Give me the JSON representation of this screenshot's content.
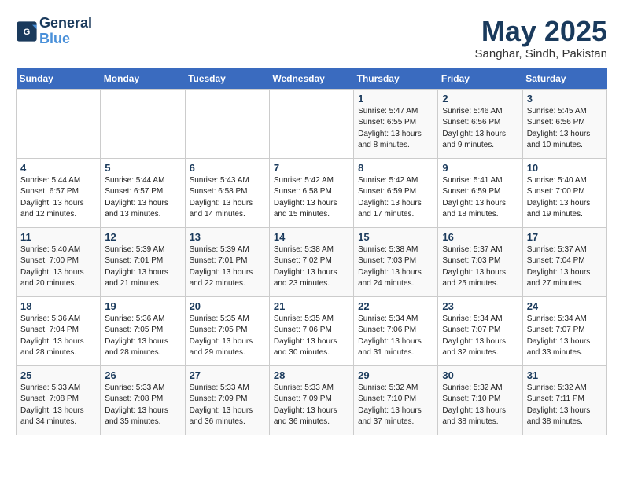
{
  "header": {
    "logo_line1": "General",
    "logo_line2": "Blue",
    "month": "May 2025",
    "location": "Sanghar, Sindh, Pakistan"
  },
  "days_of_week": [
    "Sunday",
    "Monday",
    "Tuesday",
    "Wednesday",
    "Thursday",
    "Friday",
    "Saturday"
  ],
  "weeks": [
    [
      {
        "day": "",
        "info": ""
      },
      {
        "day": "",
        "info": ""
      },
      {
        "day": "",
        "info": ""
      },
      {
        "day": "",
        "info": ""
      },
      {
        "day": "1",
        "info": "Sunrise: 5:47 AM\nSunset: 6:55 PM\nDaylight: 13 hours\nand 8 minutes."
      },
      {
        "day": "2",
        "info": "Sunrise: 5:46 AM\nSunset: 6:56 PM\nDaylight: 13 hours\nand 9 minutes."
      },
      {
        "day": "3",
        "info": "Sunrise: 5:45 AM\nSunset: 6:56 PM\nDaylight: 13 hours\nand 10 minutes."
      }
    ],
    [
      {
        "day": "4",
        "info": "Sunrise: 5:44 AM\nSunset: 6:57 PM\nDaylight: 13 hours\nand 12 minutes."
      },
      {
        "day": "5",
        "info": "Sunrise: 5:44 AM\nSunset: 6:57 PM\nDaylight: 13 hours\nand 13 minutes."
      },
      {
        "day": "6",
        "info": "Sunrise: 5:43 AM\nSunset: 6:58 PM\nDaylight: 13 hours\nand 14 minutes."
      },
      {
        "day": "7",
        "info": "Sunrise: 5:42 AM\nSunset: 6:58 PM\nDaylight: 13 hours\nand 15 minutes."
      },
      {
        "day": "8",
        "info": "Sunrise: 5:42 AM\nSunset: 6:59 PM\nDaylight: 13 hours\nand 17 minutes."
      },
      {
        "day": "9",
        "info": "Sunrise: 5:41 AM\nSunset: 6:59 PM\nDaylight: 13 hours\nand 18 minutes."
      },
      {
        "day": "10",
        "info": "Sunrise: 5:40 AM\nSunset: 7:00 PM\nDaylight: 13 hours\nand 19 minutes."
      }
    ],
    [
      {
        "day": "11",
        "info": "Sunrise: 5:40 AM\nSunset: 7:00 PM\nDaylight: 13 hours\nand 20 minutes."
      },
      {
        "day": "12",
        "info": "Sunrise: 5:39 AM\nSunset: 7:01 PM\nDaylight: 13 hours\nand 21 minutes."
      },
      {
        "day": "13",
        "info": "Sunrise: 5:39 AM\nSunset: 7:01 PM\nDaylight: 13 hours\nand 22 minutes."
      },
      {
        "day": "14",
        "info": "Sunrise: 5:38 AM\nSunset: 7:02 PM\nDaylight: 13 hours\nand 23 minutes."
      },
      {
        "day": "15",
        "info": "Sunrise: 5:38 AM\nSunset: 7:03 PM\nDaylight: 13 hours\nand 24 minutes."
      },
      {
        "day": "16",
        "info": "Sunrise: 5:37 AM\nSunset: 7:03 PM\nDaylight: 13 hours\nand 25 minutes."
      },
      {
        "day": "17",
        "info": "Sunrise: 5:37 AM\nSunset: 7:04 PM\nDaylight: 13 hours\nand 27 minutes."
      }
    ],
    [
      {
        "day": "18",
        "info": "Sunrise: 5:36 AM\nSunset: 7:04 PM\nDaylight: 13 hours\nand 28 minutes."
      },
      {
        "day": "19",
        "info": "Sunrise: 5:36 AM\nSunset: 7:05 PM\nDaylight: 13 hours\nand 28 minutes."
      },
      {
        "day": "20",
        "info": "Sunrise: 5:35 AM\nSunset: 7:05 PM\nDaylight: 13 hours\nand 29 minutes."
      },
      {
        "day": "21",
        "info": "Sunrise: 5:35 AM\nSunset: 7:06 PM\nDaylight: 13 hours\nand 30 minutes."
      },
      {
        "day": "22",
        "info": "Sunrise: 5:34 AM\nSunset: 7:06 PM\nDaylight: 13 hours\nand 31 minutes."
      },
      {
        "day": "23",
        "info": "Sunrise: 5:34 AM\nSunset: 7:07 PM\nDaylight: 13 hours\nand 32 minutes."
      },
      {
        "day": "24",
        "info": "Sunrise: 5:34 AM\nSunset: 7:07 PM\nDaylight: 13 hours\nand 33 minutes."
      }
    ],
    [
      {
        "day": "25",
        "info": "Sunrise: 5:33 AM\nSunset: 7:08 PM\nDaylight: 13 hours\nand 34 minutes."
      },
      {
        "day": "26",
        "info": "Sunrise: 5:33 AM\nSunset: 7:08 PM\nDaylight: 13 hours\nand 35 minutes."
      },
      {
        "day": "27",
        "info": "Sunrise: 5:33 AM\nSunset: 7:09 PM\nDaylight: 13 hours\nand 36 minutes."
      },
      {
        "day": "28",
        "info": "Sunrise: 5:33 AM\nSunset: 7:09 PM\nDaylight: 13 hours\nand 36 minutes."
      },
      {
        "day": "29",
        "info": "Sunrise: 5:32 AM\nSunset: 7:10 PM\nDaylight: 13 hours\nand 37 minutes."
      },
      {
        "day": "30",
        "info": "Sunrise: 5:32 AM\nSunset: 7:10 PM\nDaylight: 13 hours\nand 38 minutes."
      },
      {
        "day": "31",
        "info": "Sunrise: 5:32 AM\nSunset: 7:11 PM\nDaylight: 13 hours\nand 38 minutes."
      }
    ]
  ]
}
